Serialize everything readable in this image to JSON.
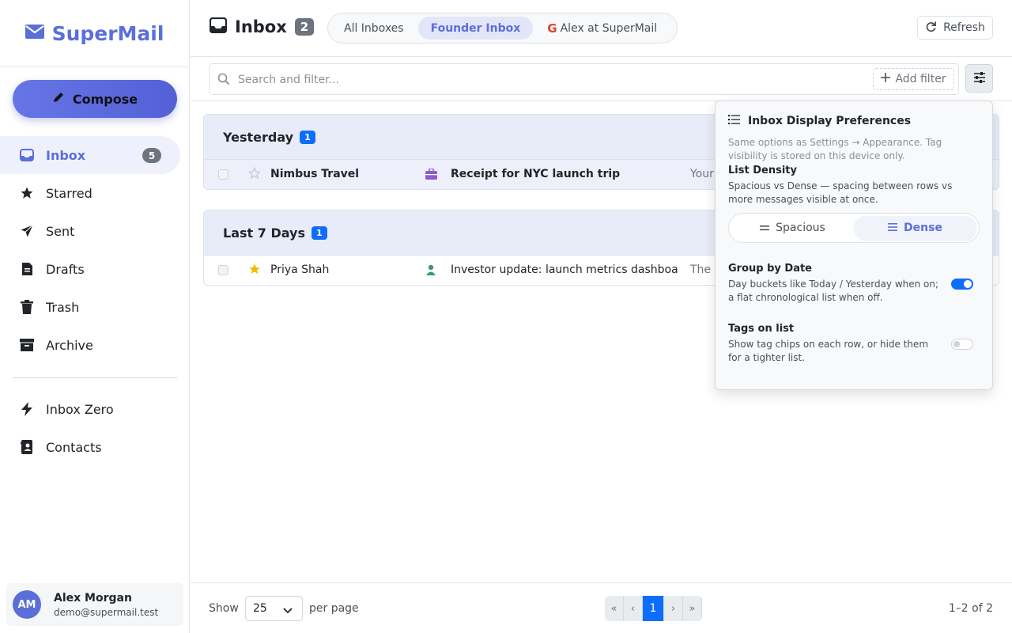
{
  "brand": {
    "name": "SuperMail"
  },
  "compose": {
    "label": "Compose"
  },
  "nav": {
    "items": [
      {
        "label": "Inbox",
        "badge": "5",
        "icon": "inbox-icon",
        "active": true
      },
      {
        "label": "Starred",
        "icon": "star-icon"
      },
      {
        "label": "Sent",
        "icon": "send-icon"
      },
      {
        "label": "Drafts",
        "icon": "file-icon"
      },
      {
        "label": "Trash",
        "icon": "trash-icon"
      },
      {
        "label": "Archive",
        "icon": "archive-icon"
      }
    ],
    "secondary": [
      {
        "label": "Inbox Zero",
        "icon": "bolt-icon"
      },
      {
        "label": "Contacts",
        "icon": "contact-book-icon"
      }
    ]
  },
  "user": {
    "initials": "AM",
    "name": "Alex Morgan",
    "email": "demo@supermail.test"
  },
  "header": {
    "title": "Inbox",
    "count": "2",
    "inbox_options": [
      "All Inboxes",
      "Founder Inbox",
      "Alex at SuperMail"
    ],
    "active_inbox": "Founder Inbox",
    "refresh_label": "Refresh"
  },
  "search": {
    "placeholder": "Search and filter...",
    "add_filter_label": "Add filter"
  },
  "groups": [
    {
      "title": "Yesterday",
      "count": "1",
      "rows": [
        {
          "sender": "Nimbus Travel",
          "subject": "Receipt for NYC launch trip",
          "snippet": "Your",
          "unread": true,
          "starred": false,
          "tag_icon": "briefcase-icon",
          "tag_color": "#8e5cc8"
        }
      ]
    },
    {
      "title": "Last 7 Days",
      "count": "1",
      "rows": [
        {
          "sender": "Priya Shah",
          "subject": "Investor update: launch metrics dashboa",
          "snippet": "The r",
          "unread": false,
          "starred": true,
          "tag_icon": "person-icon",
          "tag_color": "#3a9a6b"
        }
      ]
    }
  ],
  "prefs": {
    "title": "Inbox Display Preferences",
    "subtitle": "Same options as Settings → Appearance. Tag visibility is stored on this device only.",
    "density_label": "List Density",
    "density_desc": "Spacious vs Dense — spacing between rows vs more messages visible at once.",
    "density_options": [
      "Spacious",
      "Dense"
    ],
    "density_selected": "Dense",
    "group_label": "Group by Date",
    "group_desc": "Day buckets like Today / Yesterday when on; a flat chronological list when off.",
    "group_on": true,
    "tags_label": "Tags on list",
    "tags_desc": "Show tag chips on each row, or hide them for a tighter list.",
    "tags_on": false
  },
  "footer": {
    "show_label": "Show",
    "per_page": "25",
    "per_page_label": "per page",
    "pager": [
      "«",
      "‹",
      "1",
      "›",
      "»"
    ],
    "current_page": "1",
    "range": "1–2 of 2"
  },
  "colors": {
    "accent": "#5b6fd8",
    "primary": "#0d6efd",
    "badge": "#6c757d"
  }
}
